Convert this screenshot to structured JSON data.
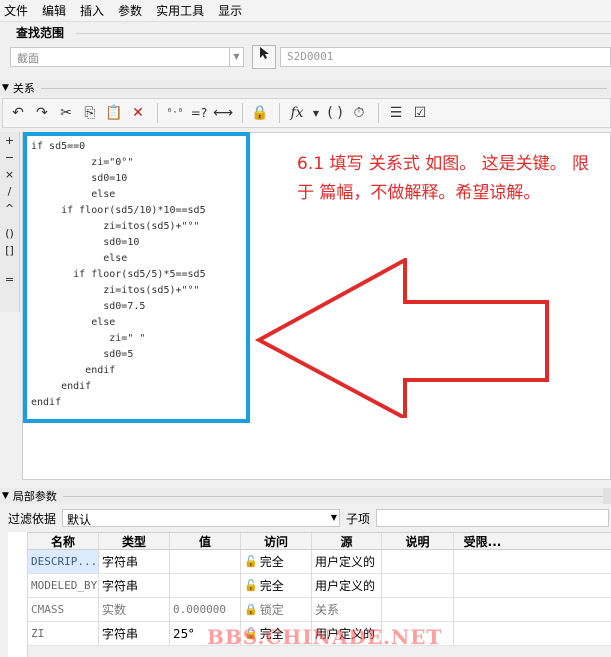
{
  "menu": [
    "文件",
    "编辑",
    "插入",
    "参数",
    "实用工具",
    "显示"
  ],
  "find": {
    "title": "查找范围",
    "lookin": "截面",
    "model": "S2D0001"
  },
  "relations": {
    "section_title": "关系",
    "side_tools": [
      "+",
      "−",
      "×",
      "/",
      "^",
      "()",
      "[]",
      "="
    ],
    "code": "if sd5==0\n          zi=\"0°\"\n          sd0=10\n          else\n     if floor(sd5/10)*10==sd5\n            zi=itos(sd5)+\"°\"\n            sd0=10\n            else\n       if floor(sd5/5)*5==sd5\n            zi=itos(sd5)+\"°\"\n            sd0=7.5\n          else\n             zi=\" \"\n            sd0=5\n         endif\n     endif\nendif",
    "annotation": "6.1 填写 关系式 如图。 这是关键。 限于 篇幅，不做解释。希望谅解。"
  },
  "local_params": {
    "section_title": "局部参数",
    "filter_label": "过滤依据",
    "filter_value": "默认",
    "sub_label": "子项",
    "columns": [
      "名称",
      "类型",
      "值",
      "访问",
      "源",
      "说明",
      "受限..."
    ],
    "rows": [
      {
        "name": "DESCRIP...",
        "type": "字符串",
        "value": "",
        "access": "完全",
        "source": "用户定义的"
      },
      {
        "name": "MODELED_BY",
        "type": "字符串",
        "value": "",
        "access": "完全",
        "source": "用户定义的"
      },
      {
        "name": "CMASS",
        "type": "实数",
        "value": "0.000000",
        "access": "锁定",
        "source": "关系"
      },
      {
        "name": "ZI",
        "type": "字符串",
        "value": "25°",
        "access": "完全",
        "source": "用户定义的"
      }
    ]
  },
  "watermark": "BBS.CHINADE.NET",
  "colors": {
    "highlight_box": "#1aa0dc",
    "annotation_red": "#e02b2b"
  }
}
